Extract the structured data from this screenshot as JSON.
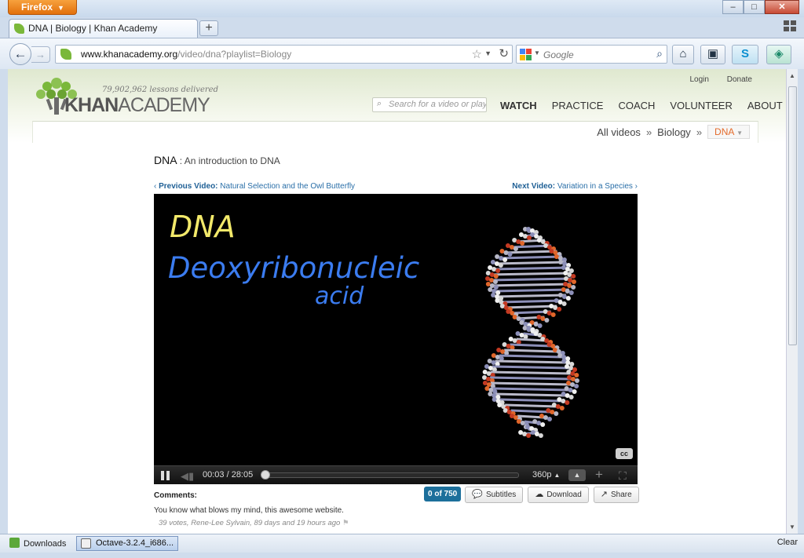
{
  "window": {
    "firefox_button": "Firefox",
    "controls": {
      "minimize": "–",
      "maximize": "□",
      "close": "✕"
    }
  },
  "tabs": [
    {
      "label": "DNA | Biology | Khan Academy",
      "icon": "khan-leaf-icon"
    }
  ],
  "navbar": {
    "url_domain": "www.khanacademy.org",
    "url_path": "/video/dna?playlist=Biology",
    "search_placeholder": "Google"
  },
  "site": {
    "lessons_delivered": "79,902,962 lessons delivered",
    "logo_bold": "KHAN",
    "logo_normal": "ACADEMY",
    "login": "Login",
    "donate": "Donate",
    "search_placeholder": "Search for a video or playlist",
    "nav": [
      "WATCH",
      "PRACTICE",
      "COACH",
      "VOLUNTEER",
      "ABOUT"
    ],
    "active_nav": "WATCH",
    "breadcrumb": {
      "all": "All videos",
      "playlist": "Biology",
      "current": "DNA"
    }
  },
  "video": {
    "title": "DNA",
    "subtitle": ": An introduction to DNA",
    "prev_label": "Previous Video:",
    "prev_title": "Natural Selection and the Owl Butterfly",
    "next_label": "Next Video:",
    "next_title": "Variation in a Species",
    "board_text_1": "DNA",
    "board_text_2": "Deoxyribonucleic",
    "board_text_3": "acid",
    "cc": "cc",
    "time": "00:03 / 28:05",
    "progress_fraction": 0.0018,
    "quality": "360p"
  },
  "comments": {
    "label": "Comments:",
    "count_badge": "0 of 750",
    "subtitles": "Subtitles",
    "download": "Download",
    "share": "Share",
    "text": "You know what blows my mind, this awesome website.",
    "meta": "39 votes, Rene-Lee Sylvain, 89 days and 19 hours ago"
  },
  "downloads": {
    "label": "Downloads",
    "item": "Octave-3.2.4_i686...",
    "clear": "Clear"
  },
  "colors": {
    "firefox_orange": "#e2700c",
    "khan_green": "#7ab83a",
    "link_blue": "#2a6fa8",
    "breadcrumb_current": "#e46b2b",
    "chalk_yellow": "#f2e96a",
    "chalk_blue": "#3b7cf0"
  }
}
